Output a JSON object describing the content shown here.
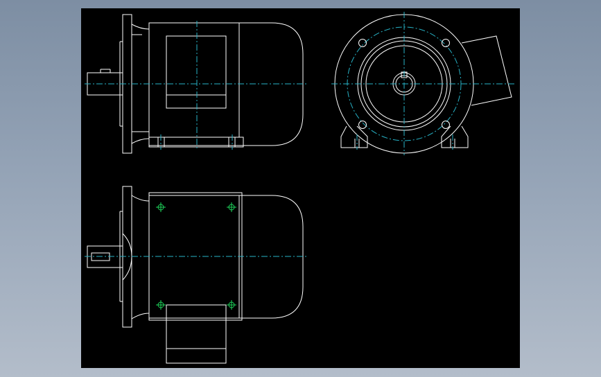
{
  "window": {
    "background": "#8797ab"
  },
  "drawing": {
    "sheet_color": "#000000",
    "line_color": "#ffffff",
    "centerline_color": "#27b3c7",
    "hole_marker_color": "#1ed35a",
    "views": [
      {
        "name": "side-view"
      },
      {
        "name": "front-view"
      },
      {
        "name": "top-view"
      }
    ]
  }
}
